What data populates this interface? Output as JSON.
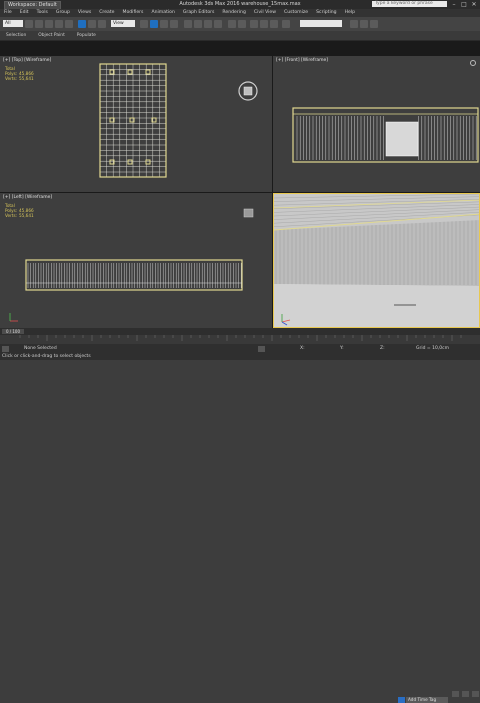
{
  "window": {
    "workspace_label": "Workspace: Default",
    "title": "Autodesk 3ds Max 2016     warehouse_15max.max",
    "search_placeholder": "Type a keyword or phrase",
    "min": "–",
    "max": "□",
    "close": "✕"
  },
  "menu": [
    "File",
    "Edit",
    "Tools",
    "Group",
    "Views",
    "Create",
    "Modifiers",
    "Animation",
    "Graph Editors",
    "Rendering",
    "Civil View",
    "Customize",
    "Scripting",
    "Help"
  ],
  "toolbar": {
    "undo_dropdown": "All",
    "view_dropdown": "View",
    "selection_set": "",
    "icons": [
      "undo-icon",
      "redo-icon",
      "link-icon",
      "unlink-icon",
      "bind-icon",
      "select-icon",
      "select-name-icon",
      "rect-select-icon",
      "window-icon",
      "move-icon",
      "rotate-icon",
      "scale-icon",
      "snap-icon",
      "angle-snap-icon",
      "percent-snap-icon",
      "spinner-snap-icon",
      "mirror-icon",
      "align-icon",
      "layer-icon",
      "curve-icon",
      "schematic-icon",
      "material-icon",
      "render-setup-icon",
      "render-frame-icon",
      "render-icon"
    ]
  },
  "ribbon": [
    "Selection",
    "Object Paint",
    "Populate"
  ],
  "viewports": {
    "top": {
      "label": "[+] [Top] [Wireframe]"
    },
    "front": {
      "label": "[+] [Front] [Wireframe]"
    },
    "left": {
      "label": "[+] [Left] [Wireframe]"
    },
    "persp": {
      "label": ""
    }
  },
  "stats": {
    "total": "Total",
    "polys_label": "Polys:",
    "polys": "45,866",
    "verts_label": "Verts:",
    "verts": "55,641"
  },
  "timeslider": {
    "value": "0 / 100"
  },
  "statusbar": {
    "selected": "None Selected",
    "prompt": "Click or click-and-drag to select objects",
    "grid": "Grid = 10,0cm",
    "add_time_tag": "Add Time Tag",
    "welcome": "Welcome to M"
  },
  "colors": {
    "active_border": "#e8c850",
    "wire": "#e0d890",
    "wire_white": "#d0d0d0",
    "stat": "#d6c45a"
  }
}
